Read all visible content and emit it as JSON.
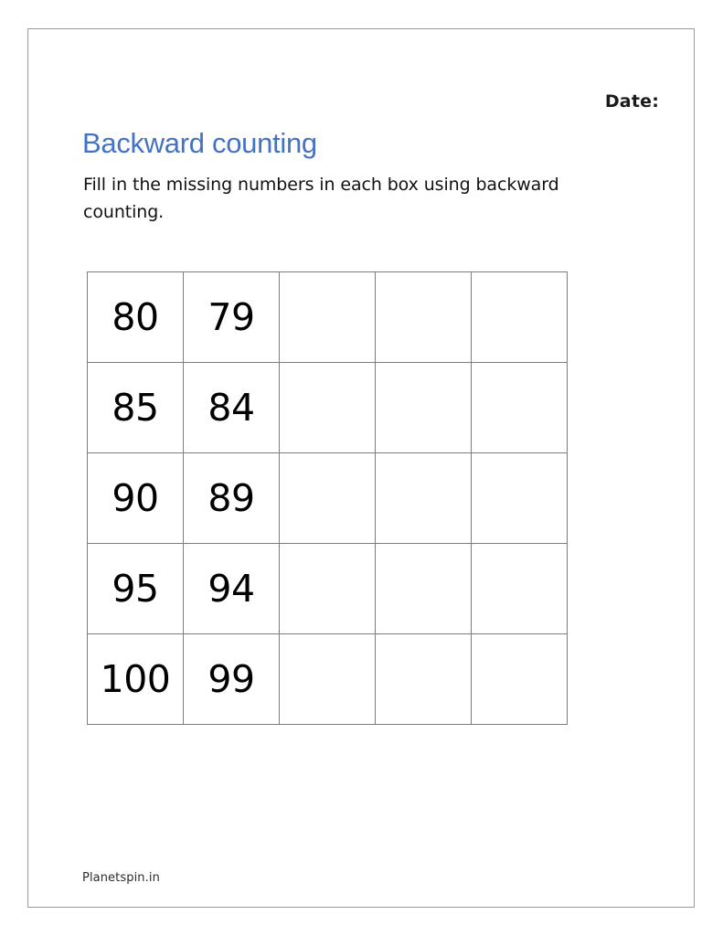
{
  "page": {
    "background_color": "#ffffff",
    "frame_border_color": "#9a9a9a"
  },
  "header": {
    "date_label": "Date:",
    "title": "Backward counting",
    "title_color": "#4472c4",
    "instructions": "Fill in the missing numbers in each box using backward counting."
  },
  "grid": {
    "columns": 5,
    "rows": 5,
    "border_color": "#7d7d7d",
    "cells": [
      [
        "80",
        "79",
        "",
        "",
        ""
      ],
      [
        "85",
        "84",
        "",
        "",
        ""
      ],
      [
        "90",
        "89",
        "",
        "",
        ""
      ],
      [
        "95",
        "94",
        "",
        "",
        ""
      ],
      [
        "100",
        "99",
        "",
        "",
        ""
      ]
    ]
  },
  "footer": {
    "credit": "Planetspin.in"
  }
}
